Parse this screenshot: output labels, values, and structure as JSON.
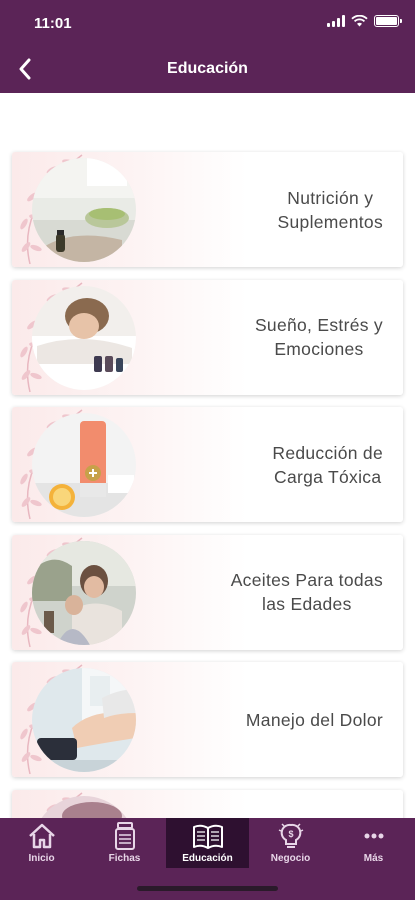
{
  "status_bar": {
    "time": "11:01"
  },
  "header": {
    "title": "Educación"
  },
  "cards": [
    {
      "label": "Nutrición y\nSuplementos",
      "image": "nutrition-photo"
    },
    {
      "label": "Sueño, Estrés y\nEmociones",
      "image": "sleep-photo"
    },
    {
      "label": "Reducción de\nCarga Tóxica",
      "image": "toxic-load-photo"
    },
    {
      "label": "Aceites Para todas\nlas Edades",
      "image": "family-photo"
    },
    {
      "label": "Manejo del Dolor",
      "image": "pain-photo"
    },
    {
      "label": "",
      "image": "partial-photo"
    }
  ],
  "tabs": [
    {
      "label": "Inicio",
      "icon": "home-icon"
    },
    {
      "label": "Fichas",
      "icon": "bottles-icon"
    },
    {
      "label": "Educación",
      "icon": "book-icon",
      "active": true
    },
    {
      "label": "Negocio",
      "icon": "lightbulb-dollar-icon"
    },
    {
      "label": "Más",
      "icon": "more-icon"
    }
  ],
  "colors": {
    "brand": "#5b2457",
    "active_tab": "#2e1030",
    "card_text": "#4a4a4a"
  }
}
